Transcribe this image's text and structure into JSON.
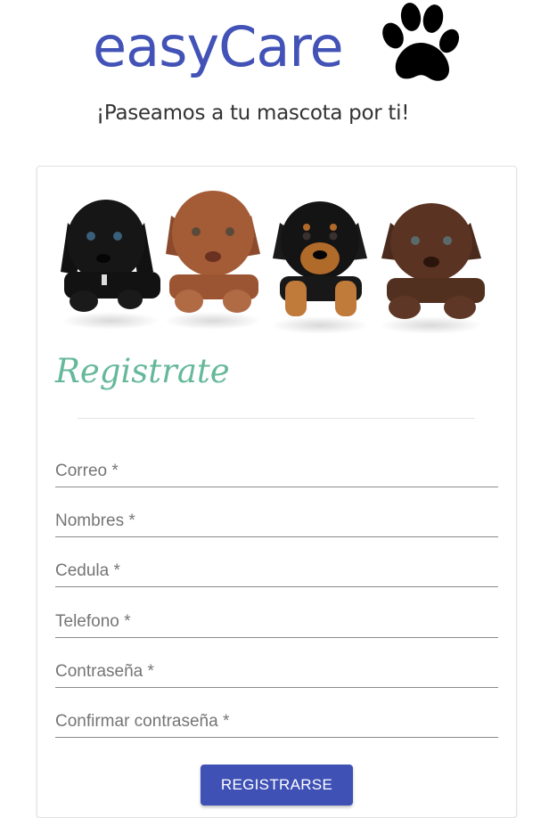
{
  "header": {
    "brand": "easyCare",
    "tagline": "¡Paseamos a tu mascota por ti!"
  },
  "form": {
    "title": "Registrate",
    "fields": [
      {
        "placeholder": "Correo *"
      },
      {
        "placeholder": "Nombres *"
      },
      {
        "placeholder": "Cedula *"
      },
      {
        "placeholder": "Telefono *"
      },
      {
        "placeholder": "Contraseña *"
      },
      {
        "placeholder": "Confirmar contraseña *"
      }
    ],
    "submit_label": "REGISTRARSE"
  },
  "colors": {
    "brand": "#4252b6",
    "title": "#66b89a",
    "button": "#3f51b5"
  },
  "icons": {
    "logo": "paw-icon"
  }
}
